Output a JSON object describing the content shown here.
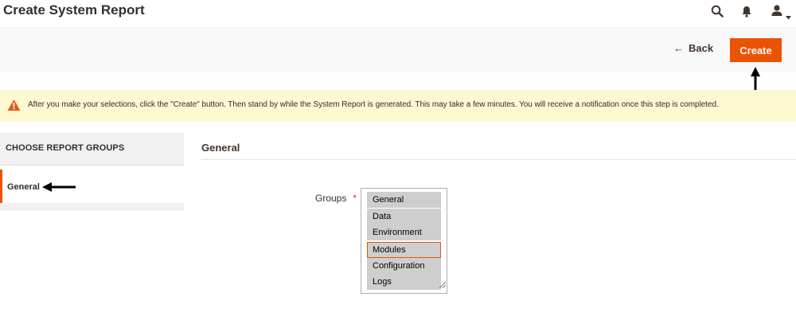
{
  "header": {
    "title": "Create System Report",
    "icons": [
      "search-icon",
      "bell-icon",
      "user-icon",
      "caret-down-icon"
    ]
  },
  "actions": {
    "back_label": "Back",
    "back_arrow": "←",
    "create_label": "Create"
  },
  "message": {
    "icon": "warning-icon",
    "text": "After you make your selections, click the \"Create\" button. Then stand by while the System Report is generated. This may take a few minutes. You will receive a notification once this step is completed."
  },
  "tabs": {
    "title": "CHOOSE REPORT GROUPS",
    "items": [
      {
        "label": "General",
        "active": true
      }
    ]
  },
  "section": {
    "title": "General",
    "field_label": "Groups",
    "required_mark": "*",
    "options": [
      "General",
      "Data",
      "Environment",
      "Modules",
      "Configuration",
      "Logs"
    ],
    "selected": [
      "General",
      "Data",
      "Environment",
      "Modules",
      "Configuration",
      "Logs"
    ],
    "focused": "Modules"
  },
  "colors": {
    "accent": "#eb5202",
    "message_bg": "#fdf8d0",
    "selected_option_bg": "#cecece"
  }
}
